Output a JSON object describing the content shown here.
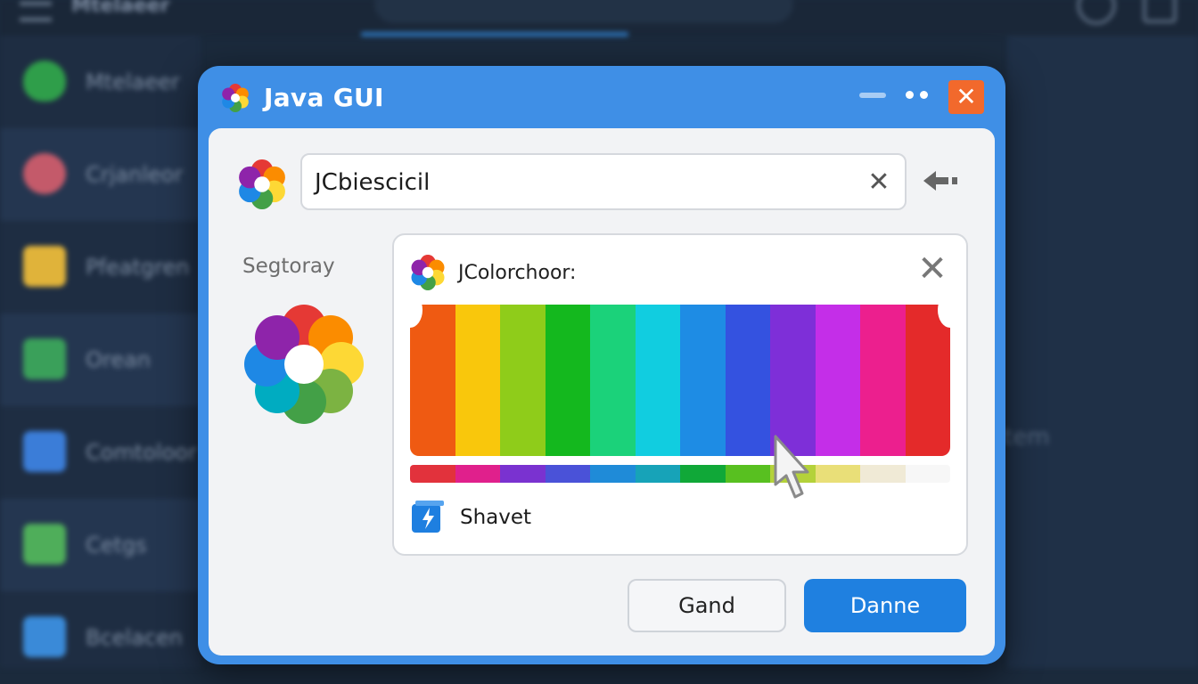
{
  "background_app": {
    "app_name": "Mtelaeer",
    "sidebar_items": [
      {
        "label": "Mtelaeer",
        "icon": "shield-icon",
        "color": "#2f9e4a"
      },
      {
        "label": "Crjanleor",
        "icon": "gear-icon",
        "color": "#c45a6a"
      },
      {
        "label": "Pfeatgren",
        "icon": "folder-icon",
        "color": "#e0b33a"
      },
      {
        "label": "Orean",
        "icon": "chart-icon",
        "color": "#3aa05a"
      },
      {
        "label": "Comtoloor",
        "icon": "grid-icon",
        "color": "#3b7dd8"
      },
      {
        "label": "Cetgs",
        "icon": "table-icon",
        "color": "#4fae5a"
      },
      {
        "label": "Bcelacen",
        "icon": "cube-icon",
        "color": "#3a8ad8"
      }
    ],
    "right_text": "atem"
  },
  "dialog": {
    "title": "Java GUI",
    "close_symbol": "✕",
    "search": {
      "value": "JCbiescicil",
      "clear_symbol": "✕"
    },
    "category_label": "Segtoray",
    "chooser": {
      "title": "JColorchoor:",
      "close_symbol": "✕",
      "swatches": [
        "#ef5a12",
        "#f9c70c",
        "#8fcc1a",
        "#14b81e",
        "#1bd27a",
        "#11cde0",
        "#1e8ce4",
        "#3452e0",
        "#7e2fd8",
        "#c42ee8",
        "#ec1f8e",
        "#e42a2a"
      ],
      "strip_colors": [
        "#e2323c",
        "#e0208c",
        "#7a32d0",
        "#4a52d8",
        "#1f8bd8",
        "#17a3b8",
        "#10a838",
        "#58c020",
        "#b4d23a",
        "#e9df78",
        "#f0ead6",
        "#f7f7f7"
      ],
      "option_label": "Shavet"
    },
    "buttons": {
      "cancel": "Gand",
      "ok": "Danne"
    }
  },
  "colors": {
    "title_bar": "#3f8fe6",
    "close_button": "#f2692c",
    "ok_button": "#1f80e0"
  }
}
